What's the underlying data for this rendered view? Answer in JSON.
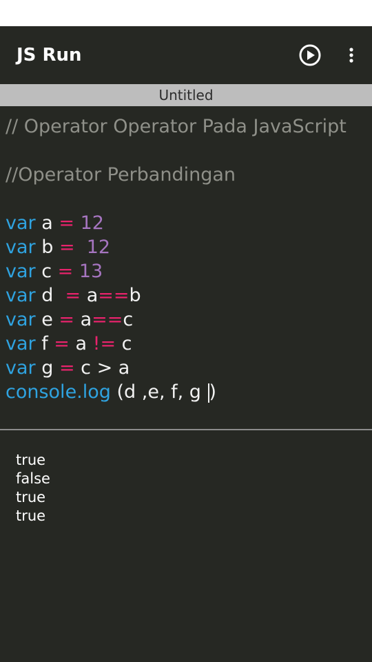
{
  "app": {
    "title": "JS Run"
  },
  "toolbar": {
    "run_icon": "play-circle-icon",
    "more_icon": "more-vert-icon"
  },
  "tab": {
    "label": "Untitled"
  },
  "editor": {
    "lines": [
      {
        "tokens": [
          {
            "t": "cmt",
            "v": "// Operator Operator Pada JavaScript"
          }
        ]
      },
      {
        "tokens": []
      },
      {
        "tokens": [
          {
            "t": "cmt",
            "v": "//Operator Perbandingan"
          }
        ]
      },
      {
        "tokens": []
      },
      {
        "tokens": [
          {
            "t": "kw",
            "v": "var"
          },
          {
            "t": "plain",
            "v": " a "
          },
          {
            "t": "op",
            "v": "="
          },
          {
            "t": "plain",
            "v": " "
          },
          {
            "t": "num",
            "v": "12"
          }
        ]
      },
      {
        "tokens": [
          {
            "t": "kw",
            "v": "var"
          },
          {
            "t": "plain",
            "v": " b "
          },
          {
            "t": "op",
            "v": "="
          },
          {
            "t": "plain",
            "v": "  "
          },
          {
            "t": "num",
            "v": "12"
          }
        ]
      },
      {
        "tokens": [
          {
            "t": "kw",
            "v": "var"
          },
          {
            "t": "plain",
            "v": " c "
          },
          {
            "t": "op",
            "v": "="
          },
          {
            "t": "plain",
            "v": " "
          },
          {
            "t": "num",
            "v": "13"
          }
        ]
      },
      {
        "tokens": [
          {
            "t": "kw",
            "v": "var"
          },
          {
            "t": "plain",
            "v": " d  "
          },
          {
            "t": "op",
            "v": "="
          },
          {
            "t": "plain",
            "v": " a"
          },
          {
            "t": "op",
            "v": "=="
          },
          {
            "t": "plain",
            "v": "b"
          }
        ]
      },
      {
        "tokens": [
          {
            "t": "kw",
            "v": "var"
          },
          {
            "t": "plain",
            "v": " e "
          },
          {
            "t": "op",
            "v": "="
          },
          {
            "t": "plain",
            "v": " a"
          },
          {
            "t": "op",
            "v": "=="
          },
          {
            "t": "plain",
            "v": "c"
          }
        ]
      },
      {
        "tokens": [
          {
            "t": "kw",
            "v": "var"
          },
          {
            "t": "plain",
            "v": " f "
          },
          {
            "t": "op",
            "v": "="
          },
          {
            "t": "plain",
            "v": " a "
          },
          {
            "t": "op",
            "v": "!="
          },
          {
            "t": "plain",
            "v": " c"
          }
        ]
      },
      {
        "tokens": [
          {
            "t": "kw",
            "v": "var"
          },
          {
            "t": "plain",
            "v": " g "
          },
          {
            "t": "op",
            "v": "="
          },
          {
            "t": "plain",
            "v": " c > a"
          }
        ]
      },
      {
        "tokens": [
          {
            "t": "kw",
            "v": "console.log"
          },
          {
            "t": "plain",
            "v": " (d ,e, f, g "
          },
          {
            "t": "caret",
            "v": ""
          },
          {
            "t": "plain",
            "v": ")"
          }
        ]
      }
    ]
  },
  "console": {
    "output": [
      "true",
      "false",
      "true",
      "true"
    ]
  },
  "colors": {
    "background": "#262823",
    "comment": "#8f9089",
    "keyword": "#2fa3e0",
    "operator": "#e8236c",
    "number": "#a675c0",
    "tab_strip": "#bdbdbd"
  }
}
